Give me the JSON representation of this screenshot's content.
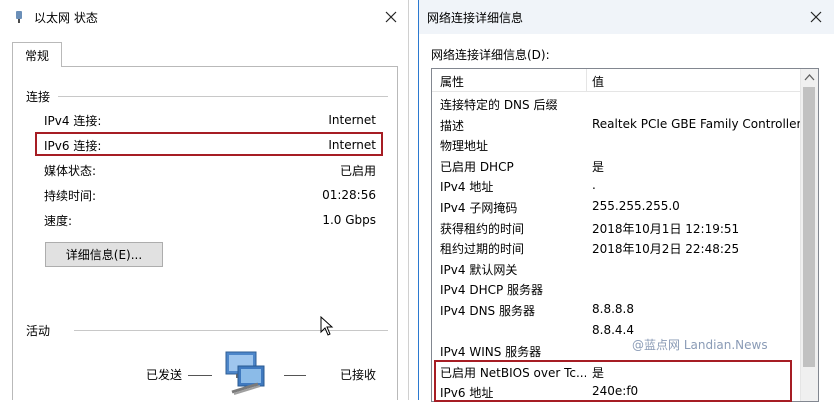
{
  "left_window": {
    "title": "以太网 状态",
    "tab_label": "常规",
    "connection": {
      "section_title": "连接",
      "rows": [
        {
          "label": "IPv4 连接:",
          "value": "Internet"
        },
        {
          "label": "IPv6 连接:",
          "value": "Internet"
        },
        {
          "label": "媒体状态:",
          "value": "已启用"
        },
        {
          "label": "持续时间:",
          "value": "01:28:56"
        },
        {
          "label": "速度:",
          "value": "1.0 Gbps"
        }
      ],
      "details_button": "详细信息(E)..."
    },
    "activity": {
      "section_title": "活动",
      "sent_label": "已发送",
      "received_label": "已接收"
    }
  },
  "right_window": {
    "title": "网络连接详细信息",
    "details_label": "网络连接详细信息(D):",
    "columns": {
      "property": "属性",
      "value": "值"
    },
    "rows": [
      {
        "property": "连接特定的 DNS 后缀",
        "value": ""
      },
      {
        "property": "描述",
        "value": "Realtek PCIe GBE Family Controller"
      },
      {
        "property": "物理地址",
        "value": ""
      },
      {
        "property": "已启用 DHCP",
        "value": "是"
      },
      {
        "property": "IPv4 地址",
        "value": "."
      },
      {
        "property": "IPv4 子网掩码",
        "value": "255.255.255.0"
      },
      {
        "property": "获得租约的时间",
        "value": "2018年10月1日 12:19:51"
      },
      {
        "property": "租约过期的时间",
        "value": "2018年10月2日 22:48:25"
      },
      {
        "property": "IPv4 默认网关",
        "value": ""
      },
      {
        "property": "IPv4 DHCP 服务器",
        "value": ""
      },
      {
        "property": "IPv4 DNS 服务器",
        "value": "8.8.8.8"
      },
      {
        "property": "",
        "value": "8.8.4.4"
      },
      {
        "property": "IPv4 WINS 服务器",
        "value": ""
      },
      {
        "property": "已启用 NetBIOS over Tc...",
        "value": "是"
      },
      {
        "property": "IPv6 地址",
        "value": "240e:f0"
      }
    ]
  },
  "watermark_text": "@蓝点网 Landian.News",
  "colors": {
    "highlight_box": "#a61d24",
    "active_border": "#2b79d0"
  }
}
